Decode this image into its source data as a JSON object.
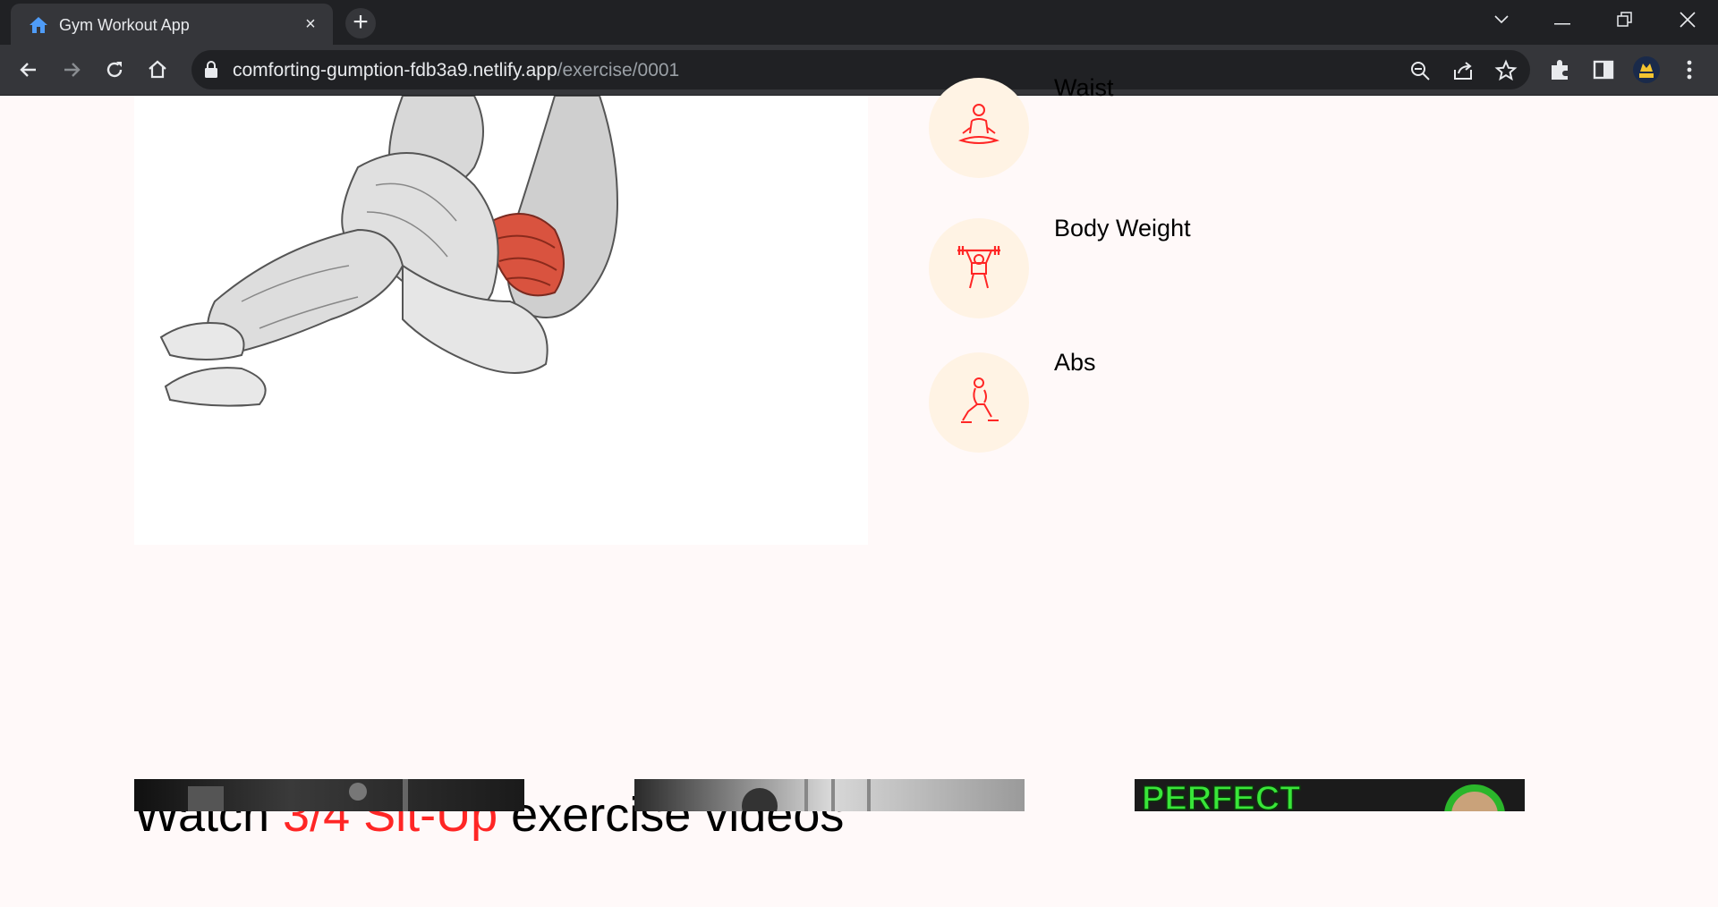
{
  "browser": {
    "tab_title": "Gym Workout App",
    "tab_close": "×",
    "new_tab": "+",
    "url_host": "comforting-gumption-fdb3a9.netlify.app",
    "url_path": "/exercise/0001"
  },
  "detail": {
    "pills": [
      {
        "label": "Waist",
        "icon": "meditation-icon"
      },
      {
        "label": "Body Weight",
        "icon": "weightlifting-icon"
      },
      {
        "label": "Abs",
        "icon": "lunge-icon"
      }
    ]
  },
  "videos": {
    "title_prefix": "Watch",
    "exercise_name": "3/4 Sit-Up",
    "title_suffix": "exercise videos",
    "thumbnail_3_text": "PERFECT"
  },
  "colors": {
    "accent": "#ff2625",
    "pill_bg": "#fff3e4",
    "page_bg": "#fff9f9",
    "chrome_dark": "#202124",
    "chrome_mid": "#35363a"
  }
}
